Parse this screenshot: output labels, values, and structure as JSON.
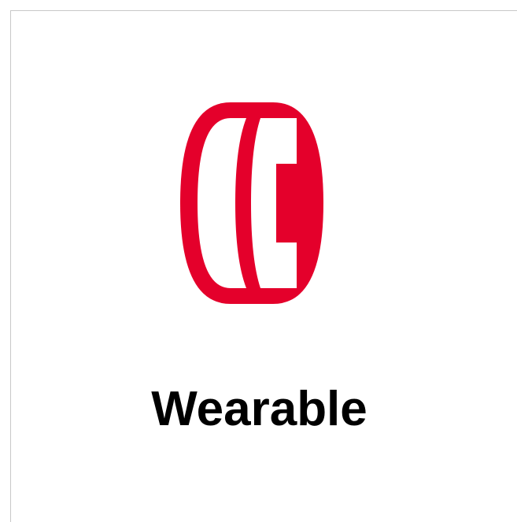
{
  "tile": {
    "label": "Wearable",
    "icon": "ring-icon",
    "accent_color": "#e4002b",
    "text_color": "#000000",
    "background_color": "#ffffff",
    "border_color": "#c8c8c8"
  }
}
